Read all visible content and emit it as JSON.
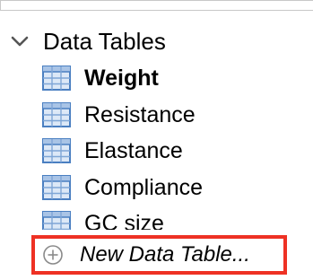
{
  "navigator": {
    "section": {
      "label": "Data Tables",
      "icon": "chevron-down-icon",
      "expanded": true
    },
    "items": [
      {
        "label": "Weight",
        "icon": "data-table-icon",
        "selected": true
      },
      {
        "label": "Resistance",
        "icon": "data-table-icon",
        "selected": false
      },
      {
        "label": "Elastance",
        "icon": "data-table-icon",
        "selected": false
      },
      {
        "label": "Compliance",
        "icon": "data-table-icon",
        "selected": false
      },
      {
        "label": "GC size",
        "icon": "data-table-icon",
        "selected": false
      }
    ],
    "new_item": {
      "label": "New Data Table...",
      "icon": "plus-circle-icon",
      "highlight_color": "#ee3124"
    }
  },
  "colors": {
    "icon_blue": "#4a7fc1",
    "icon_fill": "#dce8f7",
    "icon_grid": "#7fa6d6",
    "chevron": "#555555",
    "plus": "#8a8a8a"
  }
}
